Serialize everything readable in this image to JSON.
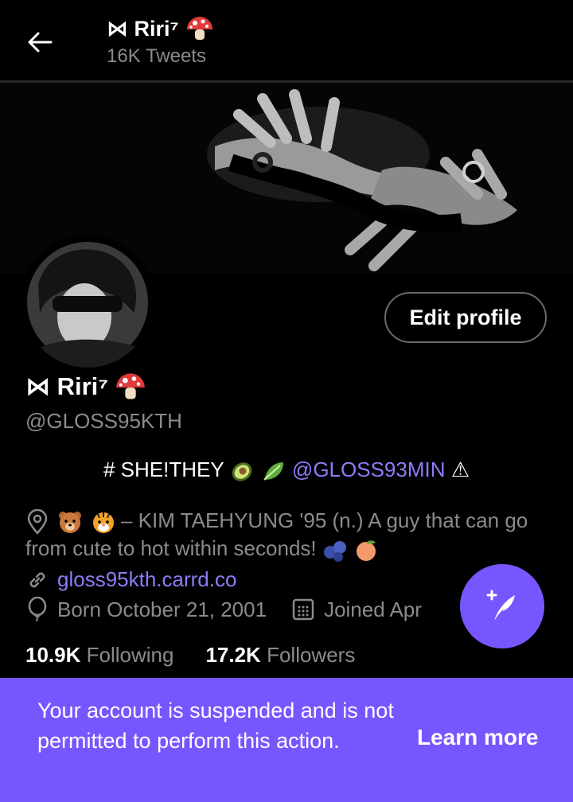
{
  "header": {
    "name": "⋈ Riri⁷",
    "tweet_count": "16K Tweets"
  },
  "profile": {
    "edit_button": "Edit profile",
    "name": "⋈ Riri⁷",
    "handle": "@GLOSS95KTH",
    "bio_line1_prefix": "# SHE!THEY",
    "bio_line1_mention": "@GLOSS93MIN",
    "bio_line1_suffix": "⚠",
    "bio_line2": "– KIM TAEHYUNG '95 (n.) A guy that can go from cute to hot within seconds!",
    "link": "gloss95kth.carrd.co",
    "born": "Born October 21, 2001",
    "joined": "Joined Apr",
    "following_count": "10.9K",
    "following_label": "Following",
    "followers_count": "17.2K",
    "followers_label": "Followers"
  },
  "toast": {
    "message": "Your account is suspended and is not permitted to perform this action.",
    "action": "Learn more"
  },
  "colors": {
    "accent": "#7856ff",
    "link": "#8b7df9",
    "muted": "#8b8b8b"
  }
}
